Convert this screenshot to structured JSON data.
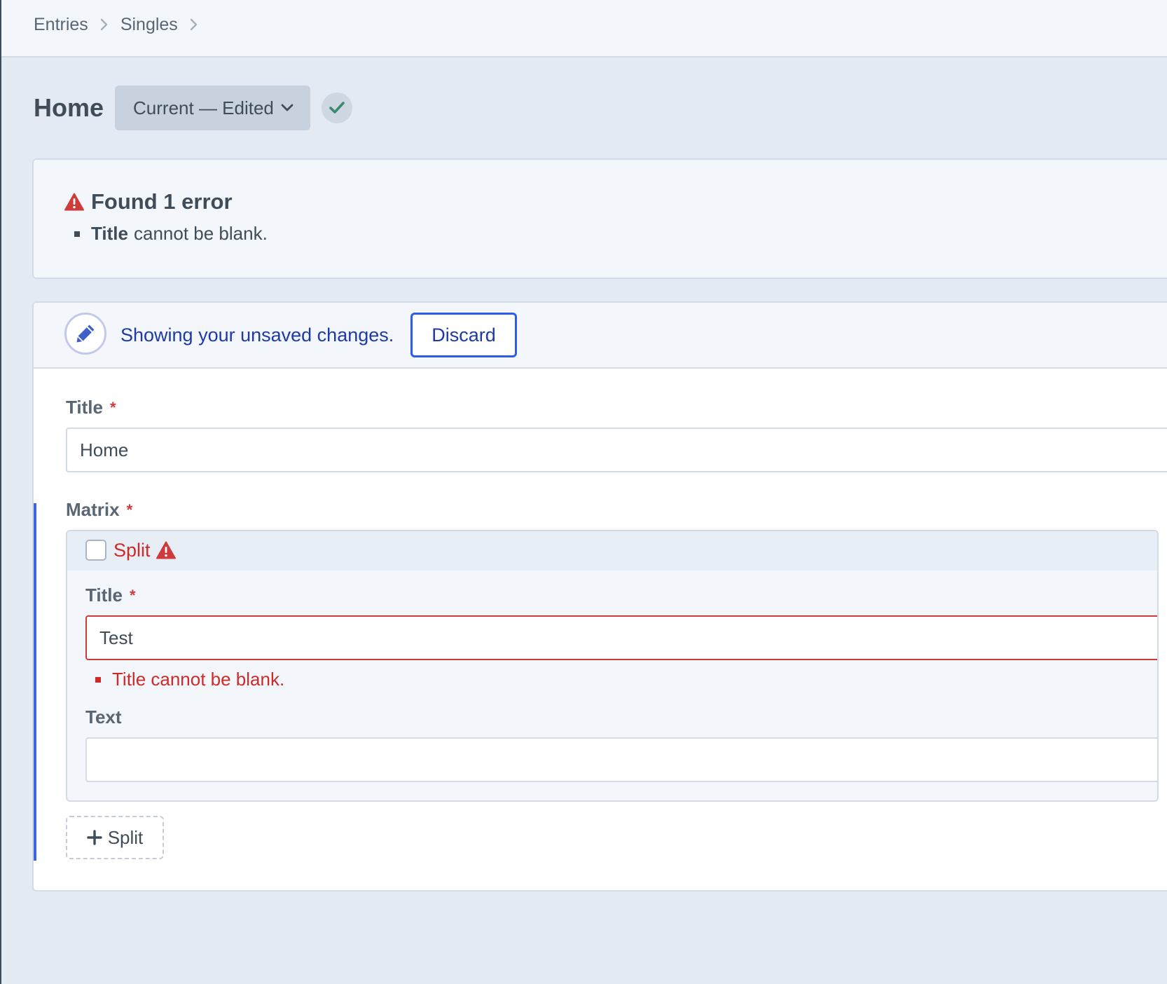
{
  "breadcrumb": {
    "items": [
      "Entries",
      "Singles"
    ]
  },
  "header": {
    "title": "Home",
    "revision_label": "Current — Edited",
    "status_icon": "check-icon"
  },
  "errors": {
    "heading": "Found 1 error",
    "items": [
      {
        "field": "Title",
        "message": "cannot be blank."
      }
    ]
  },
  "notice": {
    "text": "Showing your unsaved changes.",
    "discard_label": "Discard",
    "icon": "pencil-icon"
  },
  "fields": {
    "title": {
      "label": "Title",
      "required_mark": "*",
      "value": "Home"
    },
    "matrix": {
      "label": "Matrix",
      "required_mark": "*",
      "blocks": [
        {
          "type_label": "Split",
          "fields": {
            "title": {
              "label": "Title",
              "required_mark": "*",
              "value": "Test",
              "error": "Title cannot be blank."
            },
            "text": {
              "label": "Text",
              "value": ""
            }
          }
        }
      ],
      "add_button_label": "Split"
    }
  },
  "colors": {
    "accent": "#3c65e0",
    "error": "#cf2a2a",
    "notice_text": "#1f3aa8",
    "success": "#3d8a6e"
  }
}
